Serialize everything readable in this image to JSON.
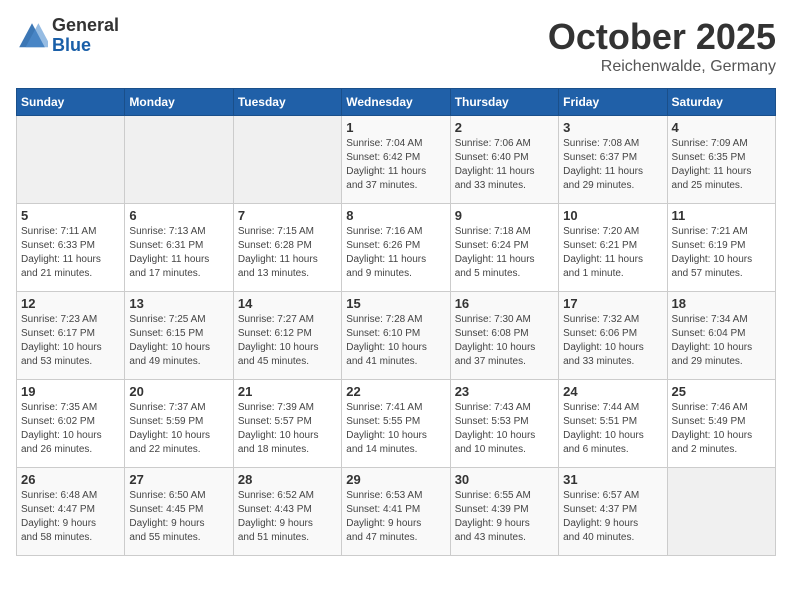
{
  "logo": {
    "general": "General",
    "blue": "Blue"
  },
  "title": "October 2025",
  "subtitle": "Reichenwalde, Germany",
  "weekdays": [
    "Sunday",
    "Monday",
    "Tuesday",
    "Wednesday",
    "Thursday",
    "Friday",
    "Saturday"
  ],
  "weeks": [
    [
      {
        "day": "",
        "info": ""
      },
      {
        "day": "",
        "info": ""
      },
      {
        "day": "",
        "info": ""
      },
      {
        "day": "1",
        "info": "Sunrise: 7:04 AM\nSunset: 6:42 PM\nDaylight: 11 hours\nand 37 minutes."
      },
      {
        "day": "2",
        "info": "Sunrise: 7:06 AM\nSunset: 6:40 PM\nDaylight: 11 hours\nand 33 minutes."
      },
      {
        "day": "3",
        "info": "Sunrise: 7:08 AM\nSunset: 6:37 PM\nDaylight: 11 hours\nand 29 minutes."
      },
      {
        "day": "4",
        "info": "Sunrise: 7:09 AM\nSunset: 6:35 PM\nDaylight: 11 hours\nand 25 minutes."
      }
    ],
    [
      {
        "day": "5",
        "info": "Sunrise: 7:11 AM\nSunset: 6:33 PM\nDaylight: 11 hours\nand 21 minutes."
      },
      {
        "day": "6",
        "info": "Sunrise: 7:13 AM\nSunset: 6:31 PM\nDaylight: 11 hours\nand 17 minutes."
      },
      {
        "day": "7",
        "info": "Sunrise: 7:15 AM\nSunset: 6:28 PM\nDaylight: 11 hours\nand 13 minutes."
      },
      {
        "day": "8",
        "info": "Sunrise: 7:16 AM\nSunset: 6:26 PM\nDaylight: 11 hours\nand 9 minutes."
      },
      {
        "day": "9",
        "info": "Sunrise: 7:18 AM\nSunset: 6:24 PM\nDaylight: 11 hours\nand 5 minutes."
      },
      {
        "day": "10",
        "info": "Sunrise: 7:20 AM\nSunset: 6:21 PM\nDaylight: 11 hours\nand 1 minute."
      },
      {
        "day": "11",
        "info": "Sunrise: 7:21 AM\nSunset: 6:19 PM\nDaylight: 10 hours\nand 57 minutes."
      }
    ],
    [
      {
        "day": "12",
        "info": "Sunrise: 7:23 AM\nSunset: 6:17 PM\nDaylight: 10 hours\nand 53 minutes."
      },
      {
        "day": "13",
        "info": "Sunrise: 7:25 AM\nSunset: 6:15 PM\nDaylight: 10 hours\nand 49 minutes."
      },
      {
        "day": "14",
        "info": "Sunrise: 7:27 AM\nSunset: 6:12 PM\nDaylight: 10 hours\nand 45 minutes."
      },
      {
        "day": "15",
        "info": "Sunrise: 7:28 AM\nSunset: 6:10 PM\nDaylight: 10 hours\nand 41 minutes."
      },
      {
        "day": "16",
        "info": "Sunrise: 7:30 AM\nSunset: 6:08 PM\nDaylight: 10 hours\nand 37 minutes."
      },
      {
        "day": "17",
        "info": "Sunrise: 7:32 AM\nSunset: 6:06 PM\nDaylight: 10 hours\nand 33 minutes."
      },
      {
        "day": "18",
        "info": "Sunrise: 7:34 AM\nSunset: 6:04 PM\nDaylight: 10 hours\nand 29 minutes."
      }
    ],
    [
      {
        "day": "19",
        "info": "Sunrise: 7:35 AM\nSunset: 6:02 PM\nDaylight: 10 hours\nand 26 minutes."
      },
      {
        "day": "20",
        "info": "Sunrise: 7:37 AM\nSunset: 5:59 PM\nDaylight: 10 hours\nand 22 minutes."
      },
      {
        "day": "21",
        "info": "Sunrise: 7:39 AM\nSunset: 5:57 PM\nDaylight: 10 hours\nand 18 minutes."
      },
      {
        "day": "22",
        "info": "Sunrise: 7:41 AM\nSunset: 5:55 PM\nDaylight: 10 hours\nand 14 minutes."
      },
      {
        "day": "23",
        "info": "Sunrise: 7:43 AM\nSunset: 5:53 PM\nDaylight: 10 hours\nand 10 minutes."
      },
      {
        "day": "24",
        "info": "Sunrise: 7:44 AM\nSunset: 5:51 PM\nDaylight: 10 hours\nand 6 minutes."
      },
      {
        "day": "25",
        "info": "Sunrise: 7:46 AM\nSunset: 5:49 PM\nDaylight: 10 hours\nand 2 minutes."
      }
    ],
    [
      {
        "day": "26",
        "info": "Sunrise: 6:48 AM\nSunset: 4:47 PM\nDaylight: 9 hours\nand 58 minutes."
      },
      {
        "day": "27",
        "info": "Sunrise: 6:50 AM\nSunset: 4:45 PM\nDaylight: 9 hours\nand 55 minutes."
      },
      {
        "day": "28",
        "info": "Sunrise: 6:52 AM\nSunset: 4:43 PM\nDaylight: 9 hours\nand 51 minutes."
      },
      {
        "day": "29",
        "info": "Sunrise: 6:53 AM\nSunset: 4:41 PM\nDaylight: 9 hours\nand 47 minutes."
      },
      {
        "day": "30",
        "info": "Sunrise: 6:55 AM\nSunset: 4:39 PM\nDaylight: 9 hours\nand 43 minutes."
      },
      {
        "day": "31",
        "info": "Sunrise: 6:57 AM\nSunset: 4:37 PM\nDaylight: 9 hours\nand 40 minutes."
      },
      {
        "day": "",
        "info": ""
      }
    ]
  ]
}
